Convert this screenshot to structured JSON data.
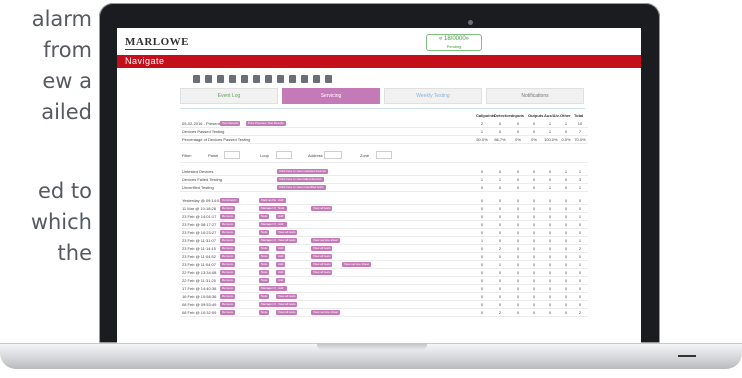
{
  "left_text_lines": [
    "alarm",
    "from",
    "ew a",
    "ailed",
    "",
    "ed to",
    "which",
    "the"
  ],
  "app": {
    "logo": "MARLOWE",
    "status_main": "« 18/0000»",
    "status_sub": "Pending",
    "nav_label": "Navigate"
  },
  "tabs": [
    {
      "label": "Event Log",
      "active": false
    },
    {
      "label": "Servicing",
      "active": true
    },
    {
      "label": "Weekly Testing",
      "active": false
    },
    {
      "label": "Notifications",
      "active": false
    }
  ],
  "table": {
    "columns": [
      "Callpoints",
      "Detectors",
      "Inputs",
      "Outputs",
      "Aux/Alv.",
      "Other",
      "Total"
    ],
    "summary_rows": [
      {
        "label": "05-02-2016 - Present",
        "tags": [
          "Test Results",
          "Print Previous Test Results"
        ],
        "values": [
          "2",
          "0",
          "0",
          "0",
          "1",
          "1",
          "10"
        ]
      },
      {
        "label": "Devices Passed Testing",
        "tags": [],
        "values": [
          "1",
          "0",
          "0",
          "0",
          "1",
          "0",
          "7"
        ]
      },
      {
        "label": "Percentage of Devices Passed Testing",
        "tags": [],
        "values": [
          "50.0%",
          "66.7%",
          "0%",
          "0%",
          "100.0%",
          "0.0%",
          "70.0%"
        ]
      }
    ],
    "filter": {
      "label": "Filter:",
      "fields": [
        "Panel",
        "Loop",
        "Address",
        "Zone"
      ]
    },
    "status_rows": [
      {
        "label": "Untested Devices",
        "tags": [
          "Click here to view untested devices"
        ],
        "values": [
          "0",
          "0",
          "0",
          "0",
          "0",
          "1",
          "1"
        ]
      },
      {
        "label": "Devices Failed Testing",
        "tags": [
          "Click here to view failed devices"
        ],
        "values": [
          "1",
          "1",
          "0",
          "0",
          "0",
          "0",
          "3"
        ]
      },
      {
        "label": "Unverified Testing",
        "tags": [
          "Click here to view unverified tests"
        ],
        "values": [
          "0",
          "0",
          "0",
          "0",
          "1",
          "0",
          "1"
        ]
      }
    ],
    "log_rows": [
      {
        "label": "Yesterday @ 09:14:01",
        "tags": [
          "Comments",
          "Mark as Rectified",
          "Add",
          "",
          "",
          ""
        ],
        "values": [
          "0",
          "0",
          "0",
          "0",
          "0",
          "0",
          "0"
        ]
      },
      {
        "label": "11 Mar @ 10:18:28",
        "tags": [
          "Remove",
          "Manager Override",
          "Note",
          "View all tests",
          ""
        ],
        "values": [
          "0",
          "0",
          "0",
          "0",
          "0",
          "0",
          "0"
        ]
      },
      {
        "label": "23 Feb @ 14:01:17",
        "tags": [
          "Remove",
          "Note",
          "Add",
          "",
          ""
        ],
        "values": [
          "0",
          "0",
          "0",
          "0",
          "0",
          "0",
          "1"
        ]
      },
      {
        "label": "23 Feb @ 08:17:27",
        "tags": [
          "Remove",
          "Manager Override",
          "Add",
          "",
          ""
        ],
        "values": [
          "0",
          "0",
          "0",
          "0",
          "0",
          "0",
          "0"
        ]
      },
      {
        "label": "23 Feb @ 10:23:27",
        "tags": [
          "Remove",
          "Note",
          "View all tests",
          ""
        ],
        "values": [
          "0",
          "0",
          "0",
          "0",
          "0",
          "0",
          "0"
        ]
      },
      {
        "label": "23 Feb @ 11:31:07",
        "tags": [
          "Remove",
          "Manager Override",
          "View all tests",
          "View service sheet"
        ],
        "values": [
          "1",
          "0",
          "0",
          "0",
          "0",
          "0",
          "1"
        ]
      },
      {
        "label": "23 Feb @ 11:14:10",
        "tags": [
          "Remove",
          "Note",
          "Add",
          "View all tests"
        ],
        "values": [
          "0",
          "2",
          "0",
          "0",
          "0",
          "0",
          "2"
        ]
      },
      {
        "label": "23 Feb @ 11:04:52",
        "tags": [
          "Remove",
          "Note",
          "Add",
          "View all tests",
          ""
        ],
        "values": [
          "0",
          "0",
          "0",
          "0",
          "0",
          "0",
          "0"
        ]
      },
      {
        "label": "23 Feb @ 11:04:07",
        "tags": [
          "Remove",
          "Note",
          "Add",
          "View all tests",
          "View service sheet"
        ],
        "values": [
          "0",
          "1",
          "0",
          "0",
          "0",
          "0",
          "1"
        ]
      },
      {
        "label": "22 Feb @ 13:34:08",
        "tags": [
          "Remove",
          "Note",
          "Add",
          "View all tests",
          ""
        ],
        "values": [
          "0",
          "0",
          "0",
          "0",
          "0",
          "0",
          "0"
        ]
      },
      {
        "label": "22 Feb @ 11:31:20",
        "tags": [
          "Remove",
          "Note",
          "Add",
          ""
        ],
        "values": [
          "0",
          "0",
          "0",
          "0",
          "0",
          "0",
          "0"
        ]
      },
      {
        "label": "17 Feb @ 14:40:38",
        "tags": [
          "Remove",
          "Manager Override",
          "Add",
          ""
        ],
        "values": [
          "0",
          "0",
          "0",
          "0",
          "0",
          "0",
          "0"
        ]
      },
      {
        "label": "16 Feb @ 10:58:36",
        "tags": [
          "Remove",
          "Note",
          "View all tests",
          ""
        ],
        "values": [
          "0",
          "0",
          "0",
          "0",
          "0",
          "0",
          "0"
        ]
      },
      {
        "label": "08 Feb @ 09:53:49",
        "tags": [
          "Remove",
          "Manager Override",
          "View all tests",
          ""
        ],
        "values": [
          "0",
          "0",
          "0",
          "0",
          "0",
          "0",
          "0"
        ]
      },
      {
        "label": "08 Feb @ 10:32:09",
        "tags": [
          "Remove",
          "Note",
          "View all tests",
          "View service sheet"
        ],
        "values": [
          "0",
          "2",
          "0",
          "0",
          "0",
          "0",
          "2"
        ]
      }
    ]
  },
  "toolbar_icons": [
    "grid-icon",
    "print-icon",
    "download-icon",
    "calendar-icon",
    "refresh-icon",
    "link-icon",
    "settings-icon",
    "edit-icon",
    "search-icon",
    "expand-icon",
    "bar-chart-icon",
    "area-chart-icon"
  ]
}
